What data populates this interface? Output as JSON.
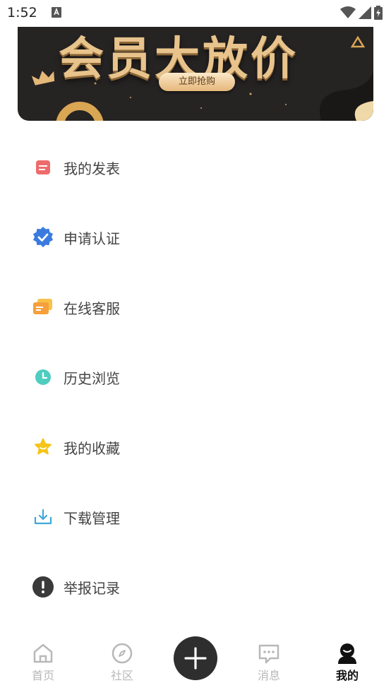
{
  "status_bar": {
    "time": "1:52"
  },
  "banner": {
    "title": "会员大放价",
    "button_label": "立即抢购"
  },
  "menu": {
    "items": [
      {
        "label": "我的发表",
        "icon": "post-icon",
        "color": "#ef6b6b"
      },
      {
        "label": "申请认证",
        "icon": "verified-badge-icon",
        "color": "#3b7be0"
      },
      {
        "label": "在线客服",
        "icon": "chat-cards-icon",
        "color": "#f5a03a"
      },
      {
        "label": "历史浏览",
        "icon": "clock-icon",
        "color": "#4ecdc0"
      },
      {
        "label": "我的收藏",
        "icon": "star-icon",
        "color": "#f5c518"
      },
      {
        "label": "下载管理",
        "icon": "download-icon",
        "color": "#3fa9d8"
      },
      {
        "label": "举报记录",
        "icon": "alert-icon",
        "color": "#3a3a3a"
      }
    ]
  },
  "tab_bar": {
    "tabs": [
      {
        "label": "首页",
        "icon": "home-icon",
        "active": false
      },
      {
        "label": "社区",
        "icon": "compass-icon",
        "active": false
      },
      {
        "label": "",
        "icon": "plus-icon",
        "active": false
      },
      {
        "label": "消息",
        "icon": "message-icon",
        "active": false
      },
      {
        "label": "我的",
        "icon": "profile-icon",
        "active": true
      }
    ]
  },
  "colors": {
    "accent_gold": "#e8c48c",
    "inactive_tab": "#b8b8b8",
    "active_tab": "#111111"
  }
}
